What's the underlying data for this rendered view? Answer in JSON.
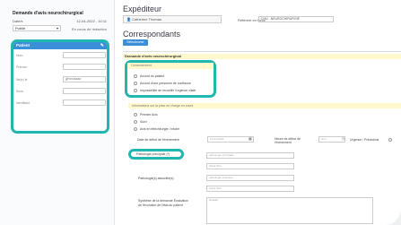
{
  "left": {
    "title": "Demande d'avis neurochirurgical",
    "date_label": "Date/s",
    "date_value": "12-04-2022 - 10:11",
    "status_select": "Publié",
    "status_note": "En cours de rédaction",
    "patient": {
      "header": "Patient",
      "fields": [
        {
          "label": "Nom",
          "value": ""
        },
        {
          "label": "Prénom",
          "value": ""
        },
        {
          "label": "Né(e) le",
          "value": "jj/mm/aaaa"
        },
        {
          "label": "Sexe",
          "value": ""
        },
        {
          "label": "Identifiant",
          "value": ""
        }
      ]
    }
  },
  "right": {
    "expediteur_title": "Expéditeur",
    "expediteur_value": "Catherine Thomas",
    "referent_label": "Référent en force",
    "referent_value": "CHU - NEUROCHIRURGIE",
    "correspondants_title": "Correspondants",
    "add_button": "Sélectionner",
    "section_label": "Demande d'avis neurochirurgical",
    "consentement": {
      "title": "Consentement",
      "options": [
        "Accord du patient",
        "Accord d'une personne de confiance",
        "Impossibilité de recueillir l'urgence vitale"
      ]
    },
    "context_title": "Informations sur la prise en charge en cours",
    "context_options": [
      "Premier Avis",
      "Suivi",
      "Avis en téléchirurgie / intubé"
    ],
    "event_date_label": "Date de début de l'évènement",
    "event_date_placeholder": "12-04-2022",
    "event_time_label": "Heure de début de l'évènement",
    "event_time_placeholder": "hh:ii",
    "urgence_label": "Urgence / Précisions",
    "patho_principale": "Pathologie principale (*)",
    "patho_input_placeholder": "pathologie principale",
    "patho_input2_placeholder": "Saisir libre",
    "patho_associee": "Pathologie(s) associée(s)",
    "patho_assoc_placeholder": "pathologie associée",
    "patho_assoc2_placeholder": "Saisir libre",
    "synthese_label": "Synthèse de la demande Évaluation de l'évolution de l'état du patient",
    "synthese_placeholder": "Détaillé"
  }
}
